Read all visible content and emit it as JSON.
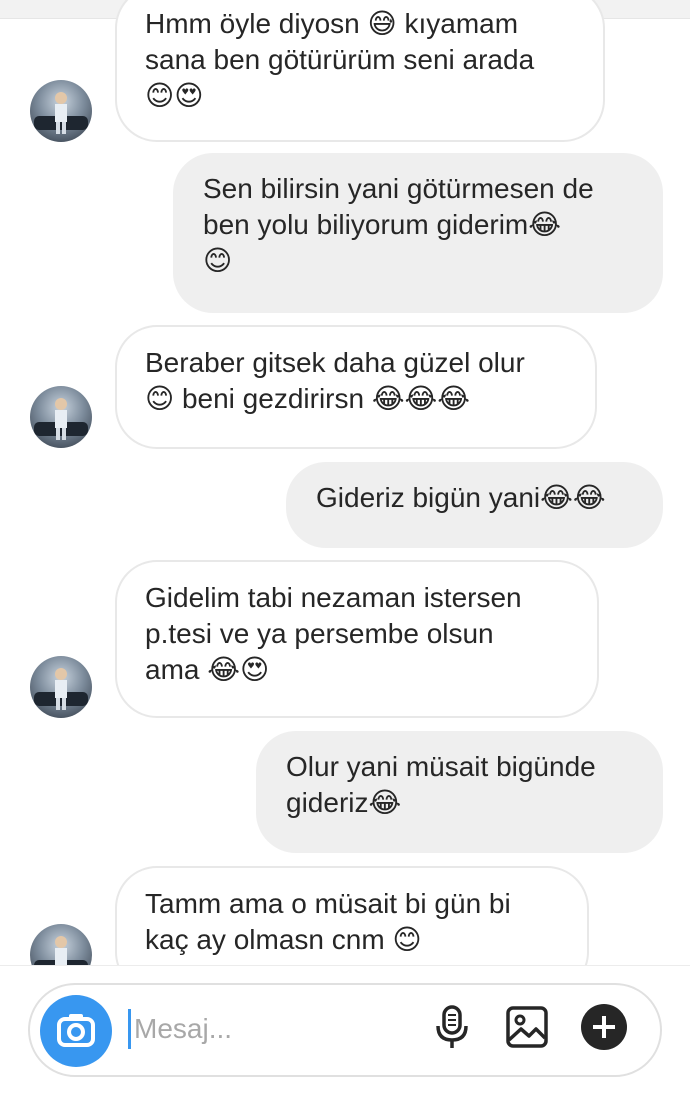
{
  "messages": [
    {
      "dir": "in",
      "text": "Hmm öyle diyosn 😅 kıyamam\nsana ben götürürüm seni arada\n😊😍",
      "avatar": true
    },
    {
      "dir": "out",
      "text": "Sen bilirsin yani götürmesen de\nben yolu biliyorum giderim😂\n😊"
    },
    {
      "dir": "in",
      "text": "Beraber gitsek daha güzel olur\n😊 beni gezdirirsn 😂😂😂",
      "avatar": true
    },
    {
      "dir": "out",
      "text": "Gideriz bigün yani😂😂"
    },
    {
      "dir": "in",
      "text": "Gidelim tabi nezaman istersen\np.tesi ve ya persembe olsun\nama 😂😍",
      "avatar": true
    },
    {
      "dir": "out",
      "text": "Olur yani müsait bigünde\ngideriz😂"
    },
    {
      "dir": "in",
      "text": "Tamm ama o müsait bi gün bi\nkaç ay olmasn cnm 😊",
      "avatar": true
    }
  ],
  "composer": {
    "placeholder": "Mesaj...",
    "camera_icon": "camera-icon",
    "mic_icon": "microphone-icon",
    "gallery_icon": "image-gallery-icon",
    "plus_icon": "plus-circle-icon"
  },
  "colors": {
    "accent": "#3897f0",
    "incoming_bubble": "#ffffff",
    "incoming_border": "#e8e8e8",
    "outgoing_bubble": "#efefef",
    "text": "#262626",
    "placeholder": "#a8a8a8"
  }
}
